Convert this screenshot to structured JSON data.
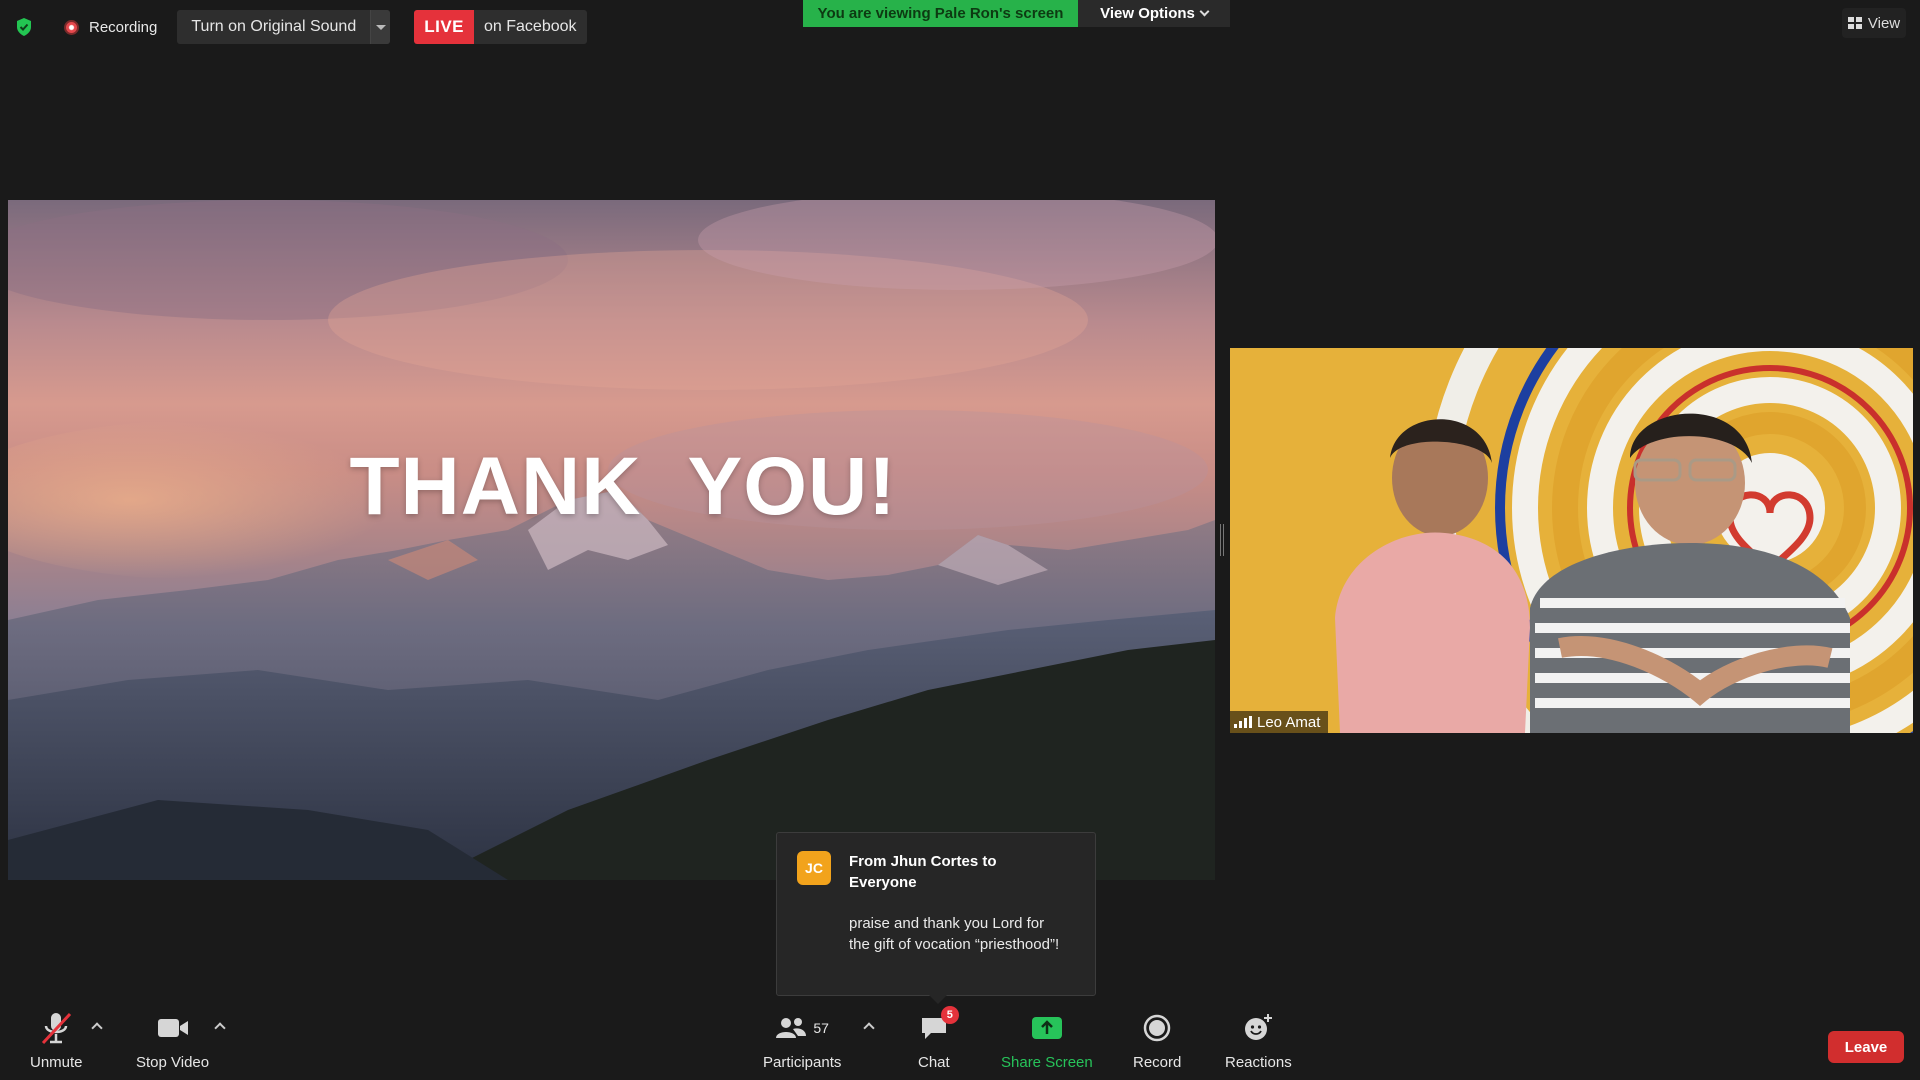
{
  "top_bar": {
    "recording_label": "Recording",
    "original_sound_label": "Turn on Original Sound",
    "live_badge": "LIVE",
    "live_target": "on Facebook",
    "viewing_banner": "You are viewing Pale Ron's screen",
    "view_options_label": "View Options",
    "view_label": "View"
  },
  "shared_screen": {
    "slide_text": "THANK  YOU!"
  },
  "participant_video": {
    "name": "Leo Amat"
  },
  "chat_toast": {
    "avatar_initials": "JC",
    "from": "From Jhun Cortes to Everyone",
    "message": "praise and thank you Lord for the gift of vocation “priesthood”!"
  },
  "toolbar": {
    "unmute_label": "Unmute",
    "stop_video_label": "Stop Video",
    "participants_count": "57",
    "participants_label": "Participants",
    "chat_label": "Chat",
    "chat_badge": "5",
    "share_screen_label": "Share Screen",
    "record_label": "Record",
    "reactions_label": "Reactions",
    "leave_label": "Leave"
  },
  "colors": {
    "background": "#1a1a1a",
    "live_red": "#e5323b",
    "banner_green": "#27b24a",
    "share_green": "#27c35a",
    "leave_red": "#d12e2e",
    "avatar_orange": "#f2a31c"
  }
}
